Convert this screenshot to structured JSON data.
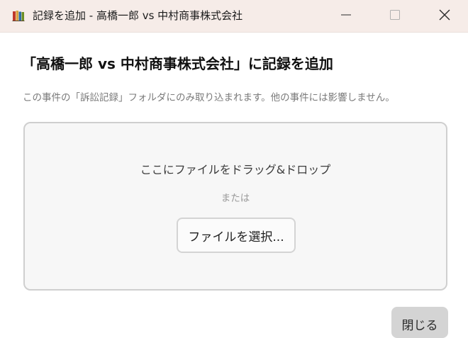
{
  "window": {
    "title": "記録を追加 - 高橋一郎 vs 中村商事株式会社",
    "app_icon": "books-icon",
    "controls": [
      "minimize-icon",
      "maximize-icon",
      "close-icon"
    ]
  },
  "dialog": {
    "heading": "「高橋一郎 vs 中村商事株式会社」に記録を追加",
    "description": "この事件の「訴訟記録」フォルダにのみ取り込まれます。他の事件には影響しません。",
    "dropzone": {
      "title": "ここにファイルをドラッグ&ドロップ",
      "or_label": "または",
      "select_button_label": "ファイルを選択..."
    },
    "close_button_label": "閉じる"
  },
  "colors": {
    "titlebar_bg": "#f6ece8",
    "dropzone_bg": "#f7f7f7",
    "dropzone_border": "#cfcfcf",
    "close_button_bg": "#d4d4d4"
  }
}
